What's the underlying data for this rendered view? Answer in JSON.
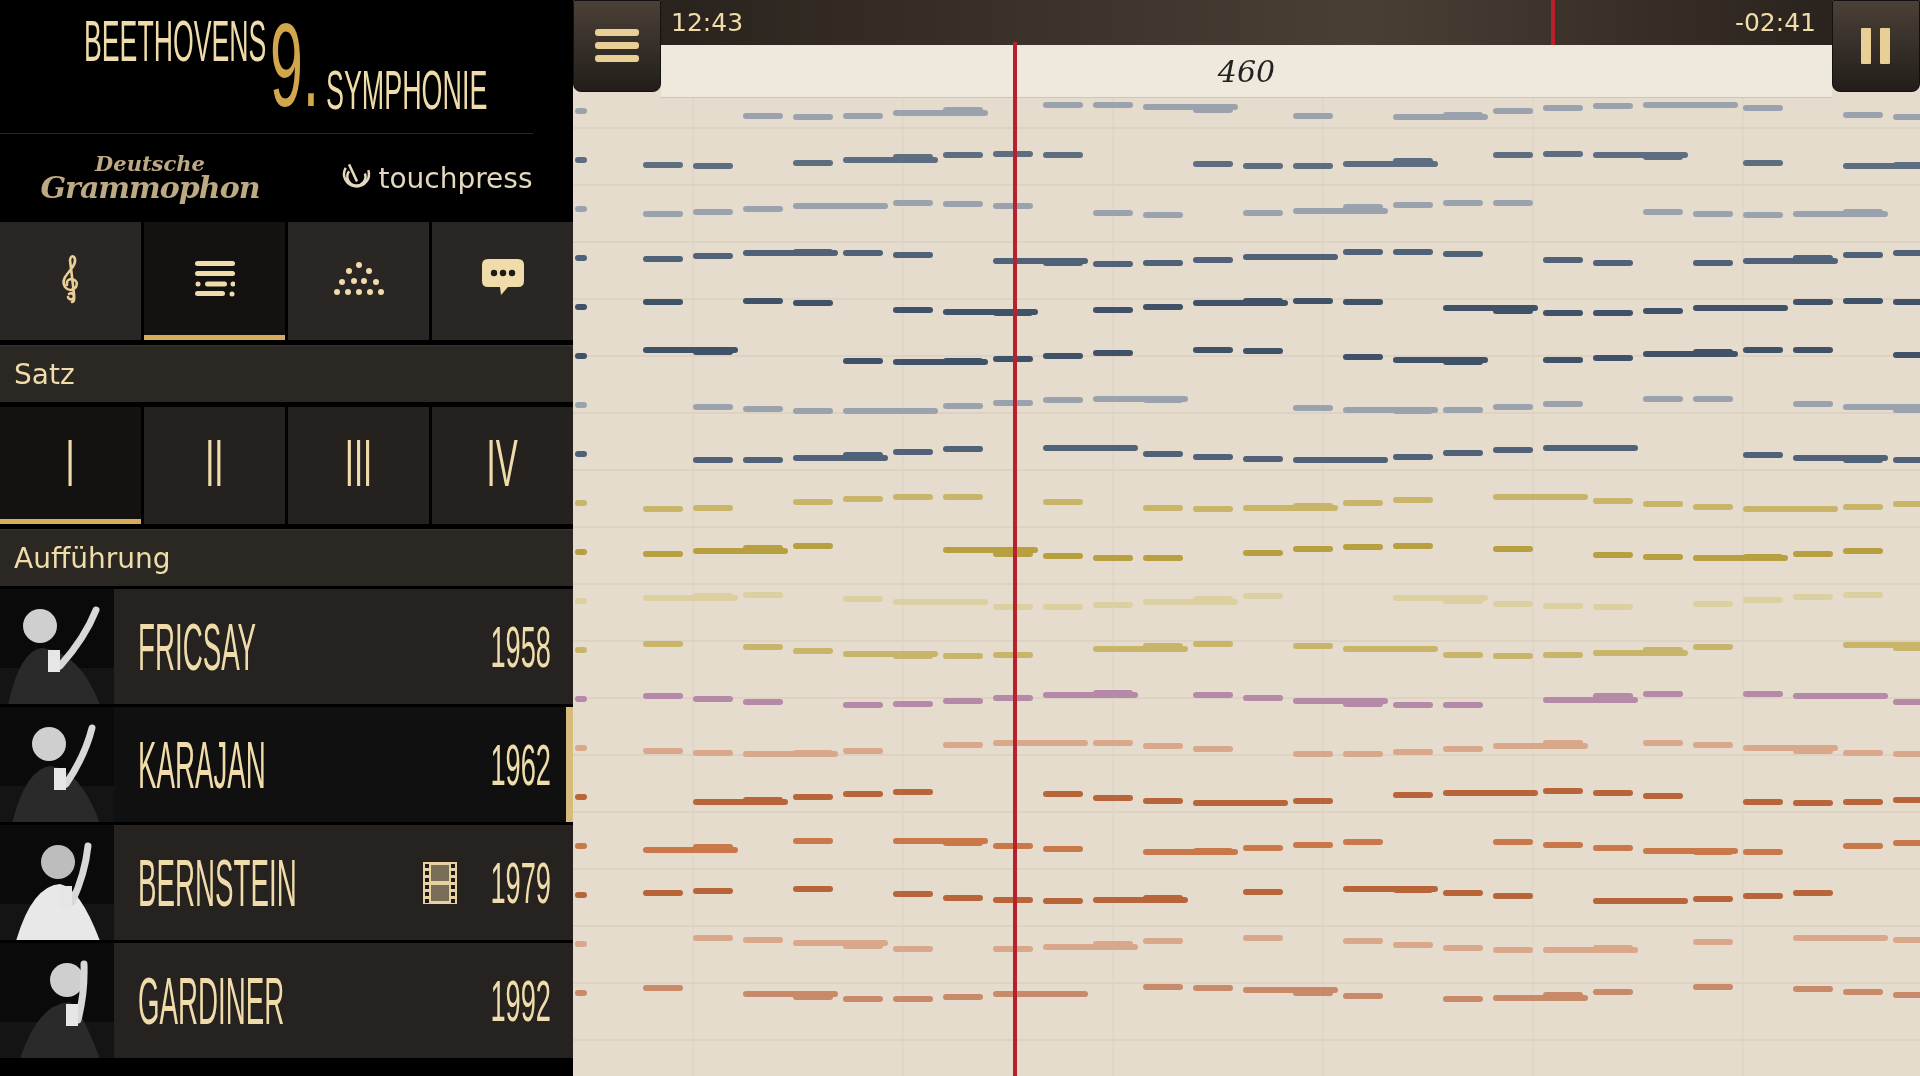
{
  "header": {
    "title_word": "BEETHOVENS",
    "title_number": "9.",
    "title_rest": "SYMPHONIE"
  },
  "logos": {
    "label_top": "Deutsche",
    "label_bottom": "Grammophon",
    "partner": "touchpress"
  },
  "tabs": [
    {
      "kind": "clef",
      "selected": false
    },
    {
      "kind": "list",
      "selected": true
    },
    {
      "kind": "orchestra",
      "selected": false
    },
    {
      "kind": "chat",
      "selected": false
    }
  ],
  "movement_heading": "Satz",
  "movements": [
    {
      "label": "I",
      "selected": true
    },
    {
      "label": "II",
      "selected": false
    },
    {
      "label": "III",
      "selected": false
    },
    {
      "label": "IV",
      "selected": false
    }
  ],
  "performance_heading": "Aufführung",
  "performances": [
    {
      "name": "FRICSAY",
      "year": "1958",
      "selected": false,
      "video": false
    },
    {
      "name": "KARAJAN",
      "year": "1962",
      "selected": true,
      "video": false
    },
    {
      "name": "BERNSTEIN",
      "year": "1979",
      "selected": false,
      "video": true
    },
    {
      "name": "GARDINER",
      "year": "1992",
      "selected": false,
      "video": false
    }
  ],
  "player": {
    "elapsed": "12:43",
    "remaining": "-02:41",
    "bar_number": "460",
    "playing": true,
    "progress": {
      "level": 0.76
    }
  }
}
